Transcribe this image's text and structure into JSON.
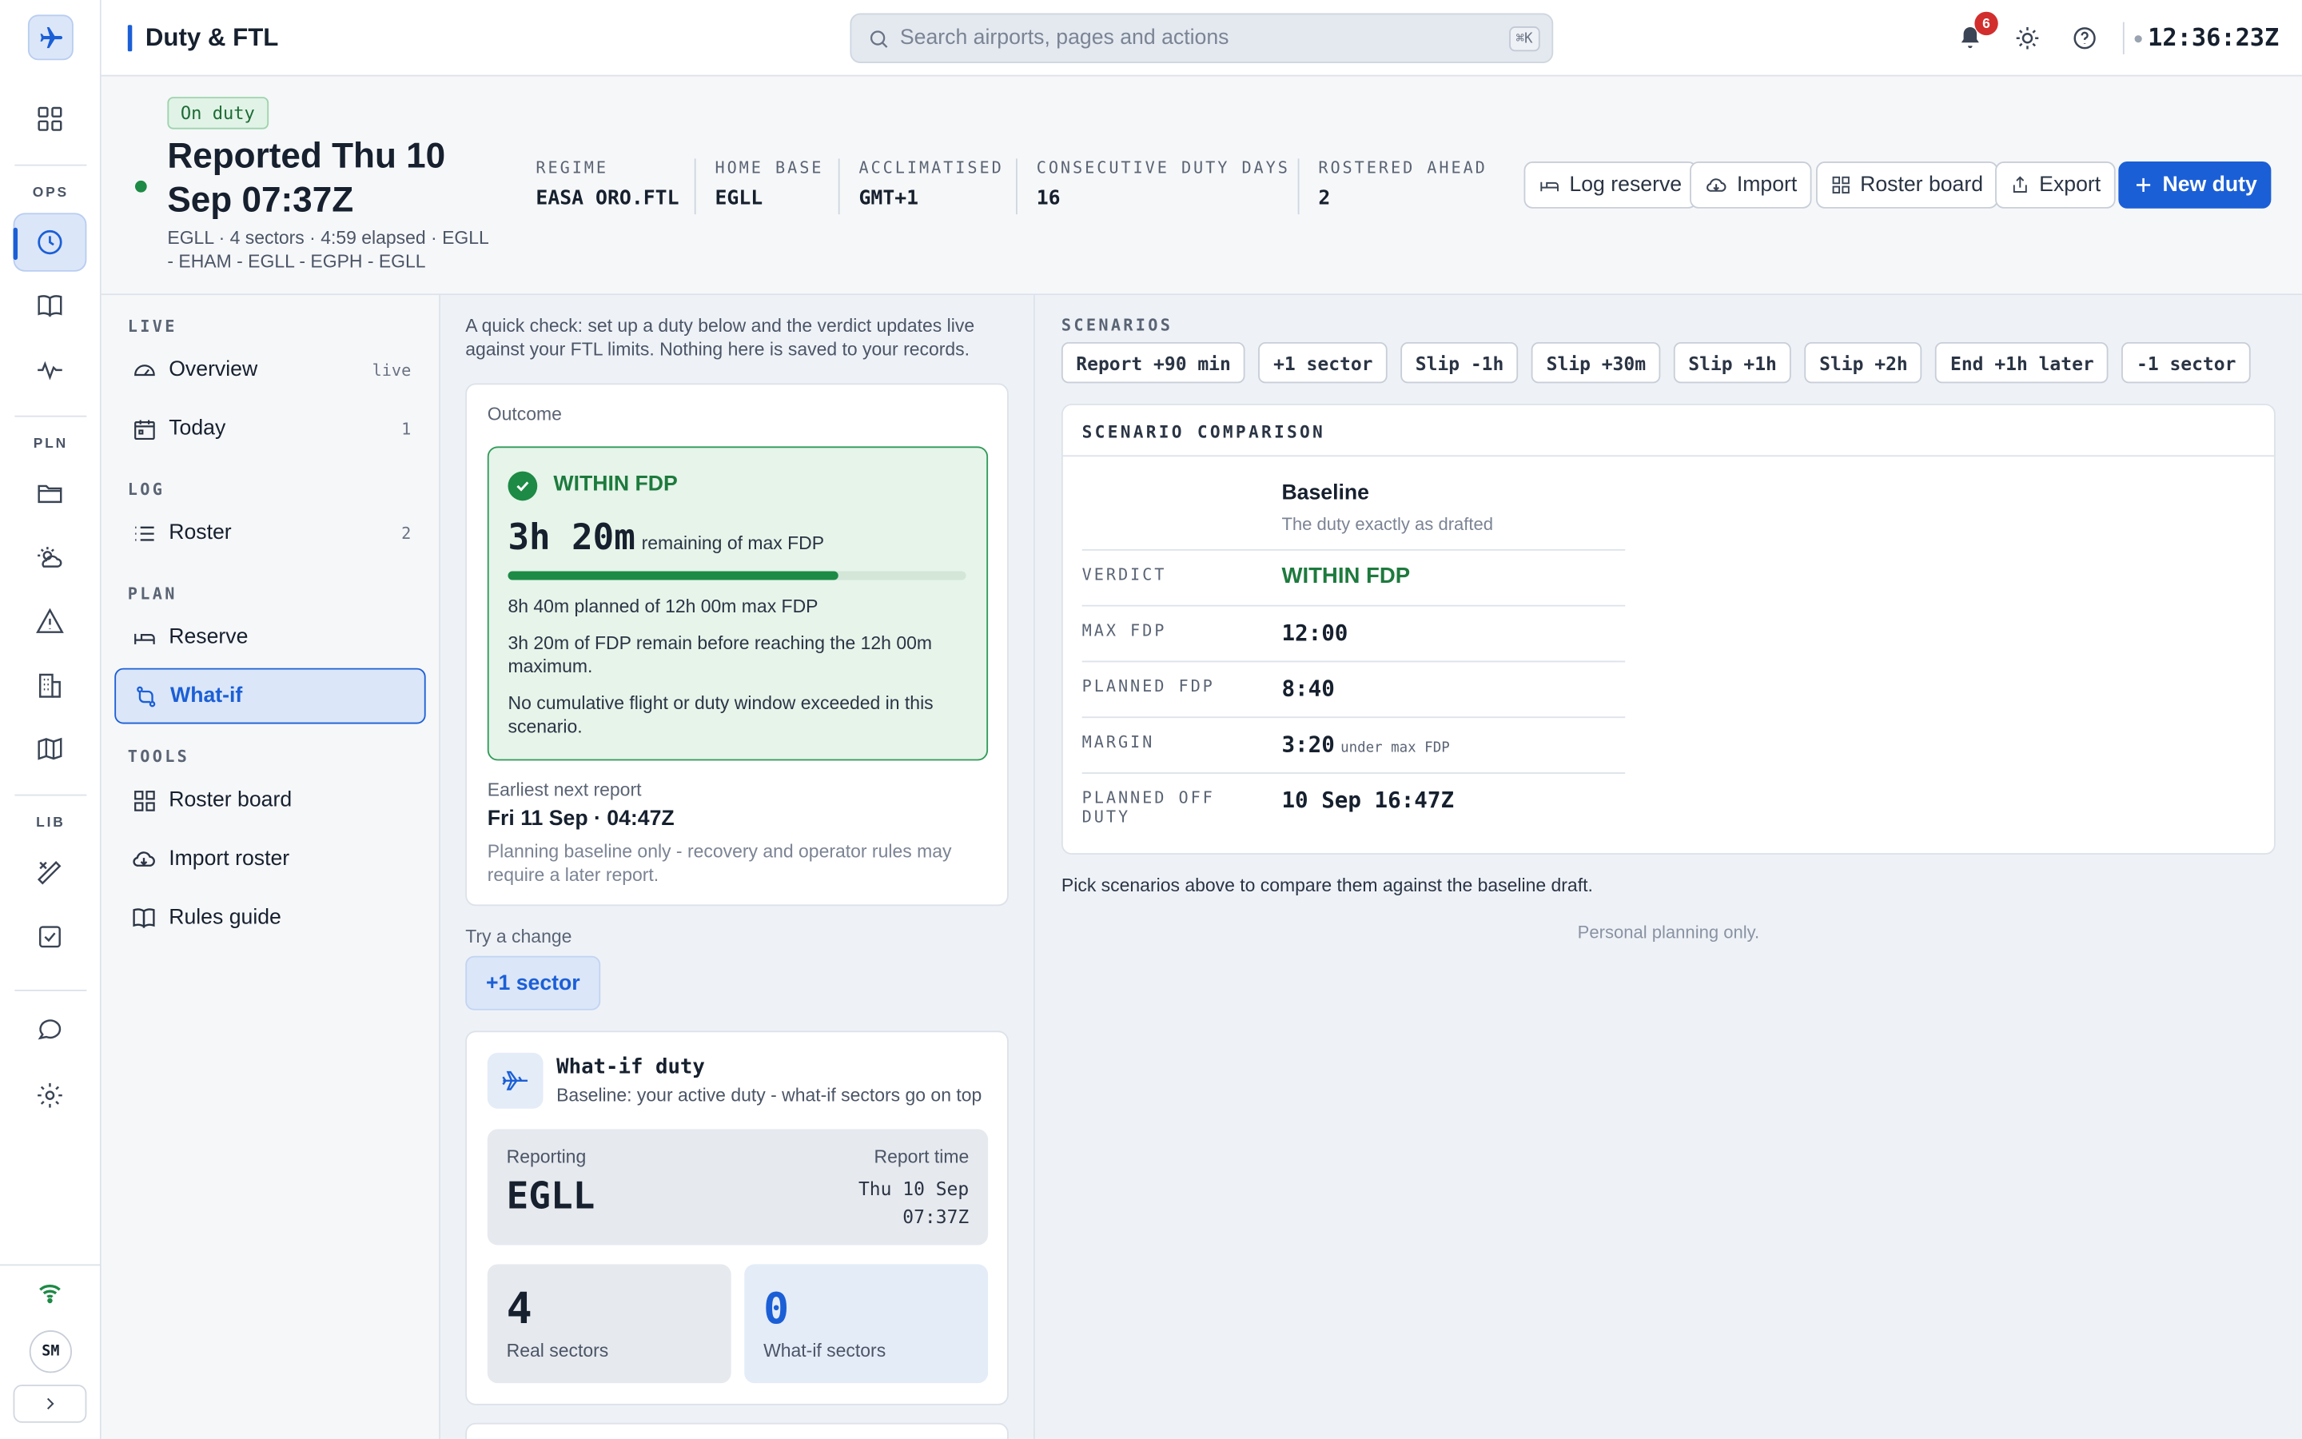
{
  "app": {
    "title": "Duty & FTL",
    "clock": "12:36:23Z",
    "notif_count": "6"
  },
  "rail": {
    "labels": {
      "ops": "OPS",
      "pln": "PLN",
      "lib": "LIB"
    },
    "icons": [
      "plane-icon",
      "dashboard-icon",
      "clock-icon",
      "book-icon",
      "activity-icon",
      "folder-icon",
      "weather-icon",
      "warning-icon",
      "building-icon",
      "map-icon",
      "tools-icon",
      "checkbox-icon",
      "chat-icon",
      "settings-icon",
      "wifi-icon"
    ],
    "avatar": "SM"
  },
  "search": {
    "placeholder": "Search airports, pages and actions",
    "shortcut": "⌘K"
  },
  "header": {
    "status_badge": "On duty",
    "title": "Reported Thu 10 Sep 07:37Z",
    "subtitle": "EGLL · 4 sectors · 4:59 elapsed · EGLL - EHAM - EGLL - EGPH - EGLL",
    "stats": [
      {
        "label": "REGIME",
        "value": "EASA ORO.FTL"
      },
      {
        "label": "HOME BASE",
        "value": "EGLL"
      },
      {
        "label": "ACCLIMATISED",
        "value": "GMT+1"
      },
      {
        "label": "CONSECUTIVE DUTY DAYS",
        "value": "16"
      },
      {
        "label": "ROSTERED AHEAD",
        "value": "2"
      }
    ],
    "buttons": {
      "log_reserve": "Log reserve",
      "import": "Import",
      "roster_board": "Roster board",
      "export": "Export",
      "new_duty": "New duty"
    }
  },
  "sidebar": {
    "groups": {
      "live": "LIVE",
      "log": "LOG",
      "plan": "PLAN",
      "tools": "TOOLS"
    },
    "items": {
      "overview": {
        "label": "Overview",
        "count": "live"
      },
      "today": {
        "label": "Today",
        "count": "1"
      },
      "roster": {
        "label": "Roster",
        "count": "2"
      },
      "reserve": {
        "label": "Reserve"
      },
      "whatif": {
        "label": "What-if"
      },
      "roster_board": {
        "label": "Roster board"
      },
      "import_roster": {
        "label": "Import roster"
      },
      "rules_guide": {
        "label": "Rules guide"
      }
    }
  },
  "whatif": {
    "intro": "A quick check: set up a duty below and the verdict updates live against your FTL limits. Nothing here is saved to your records.",
    "outcome_label": "Outcome",
    "verdict": "WITHIN FDP",
    "remaining_value": "3h 20m",
    "remaining_label": "remaining of max FDP",
    "progress": 0.7222,
    "planned_line": "8h 40m planned of 12h 00m max FDP",
    "remain_line": "3h 20m of FDP remain before reaching the 12h 00m maximum.",
    "cumulative_line": "No cumulative flight or duty window exceeded in this scenario.",
    "next_report_label": "Earliest next report",
    "next_report_value": "Fri 11 Sep · 04:47Z",
    "next_report_note": "Planning baseline only - recovery and operator rules may require a later report.",
    "try_label": "Try a change",
    "try_button": "+1 sector",
    "duty_title": "What-if duty",
    "duty_subtitle": "Baseline: your active duty - what-if sectors go on top",
    "reporting_label": "Reporting",
    "reporting_value": "EGLL",
    "report_time_label": "Report time",
    "report_time_date": "Thu 10 Sep",
    "report_time_time": "07:37Z",
    "real_sectors_value": "4",
    "real_sectors_label": "Real sectors",
    "whatif_sectors_value": "0",
    "whatif_sectors_label": "What-if sectors"
  },
  "scenarios": {
    "label": "SCENARIOS",
    "chips": [
      "Report +90 min",
      "+1 sector",
      "Slip -1h",
      "Slip +30m",
      "Slip +1h",
      "Slip +2h",
      "End +1h later",
      "-1 sector"
    ],
    "comparison_title": "SCENARIO COMPARISON",
    "baseline_title": "Baseline",
    "baseline_subtitle": "The duty exactly as drafted",
    "rows": [
      {
        "key": "VERDICT",
        "value": "WITHIN FDP"
      },
      {
        "key": "MAX FDP",
        "value": "12:00"
      },
      {
        "key": "PLANNED FDP",
        "value": "8:40"
      },
      {
        "key": "MARGIN",
        "value": "3:20",
        "note": "under max FDP"
      },
      {
        "key": "PLANNED OFF DUTY",
        "value": "10 Sep 16:47Z"
      }
    ],
    "hint": "Pick scenarios above to compare them against the baseline draft.",
    "footer": "Personal planning only."
  },
  "colors": {
    "accent": "#1b5fd6",
    "ok": "#1d8a45",
    "alert": "#d22e2e"
  }
}
